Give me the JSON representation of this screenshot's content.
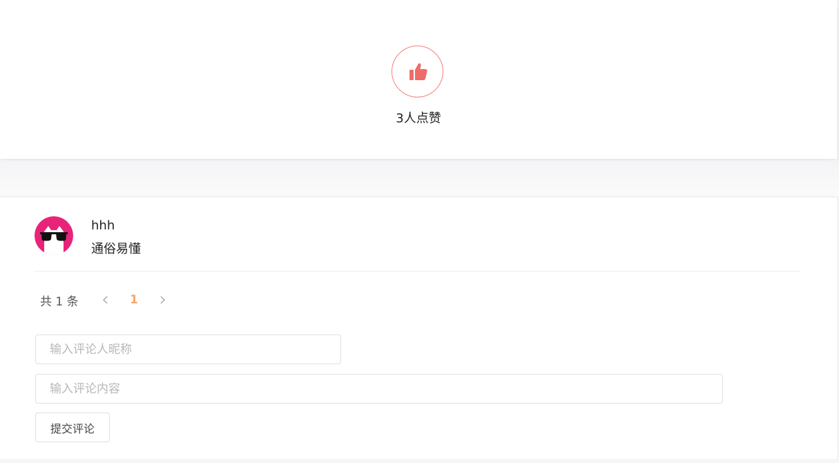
{
  "like": {
    "icon": "thumbs-up-icon",
    "count_text": "3人点赞",
    "accent_color": "#f06b6b"
  },
  "comments": [
    {
      "avatar": "cat-sunglasses-avatar",
      "name": "hhh",
      "text": "通俗易懂"
    }
  ],
  "pagination": {
    "total_text": "共 1 条",
    "current_page": "1",
    "prev_icon": "chevron-left-icon",
    "next_icon": "chevron-right-icon"
  },
  "form": {
    "nickname_placeholder": "输入评论人昵称",
    "content_placeholder": "输入评论内容",
    "nickname_value": "",
    "content_value": "",
    "submit_label": "提交评论"
  }
}
